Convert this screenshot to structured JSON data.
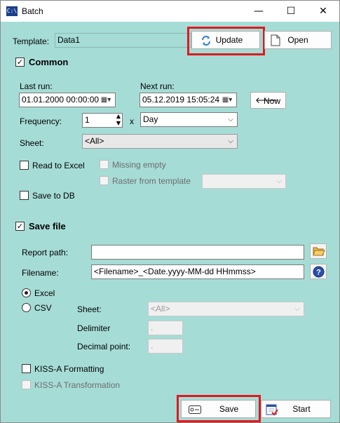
{
  "window": {
    "icon_text": "C:\\",
    "title": "Batch",
    "minimize": "—",
    "maximize": "☐",
    "close": "✕"
  },
  "template": {
    "label": "Template:",
    "value": "Data1",
    "update_label": "Update",
    "open_label": "Open"
  },
  "common": {
    "checked": true,
    "title": "Common",
    "last_run_label": "Last run:",
    "last_run_value": "01.01.2000 00:00:00",
    "next_run_label": "Next run:",
    "next_run_value": "05.12.2019 15:05:24",
    "now_label": "Now",
    "frequency_label": "Frequency:",
    "frequency_value": "1",
    "frequency_x": "x",
    "frequency_unit": "Day",
    "sheet_label": "Sheet:",
    "sheet_value": "<All>",
    "read_to_excel_label": "Read to Excel",
    "missing_empty_label": "Missing empty",
    "raster_label": "Raster from template",
    "save_to_db_label": "Save to DB"
  },
  "save_file": {
    "checked": true,
    "title": "Save file",
    "report_path_label": "Report path:",
    "report_path_value": "",
    "filename_label": "Filename:",
    "filename_value": "<Filename>_<Date.yyyy-MM-dd HHmmss>",
    "excel_label": "Excel",
    "csv_label": "CSV",
    "selected_format": "Excel",
    "sheet_label": "Sheet:",
    "sheet_value": "<All>",
    "delimiter_label": "Delimiter",
    "delimiter_value": ".",
    "decimal_label": "Decimal point:",
    "decimal_value": ".",
    "kiss_formatting_label": "KISS-A Formatting",
    "kiss_transformation_label": "KISS-A Transformation"
  },
  "footer": {
    "save_label": "Save",
    "start_label": "Start"
  },
  "colors": {
    "background": "#a6dcd6",
    "highlight": "#e0191f"
  }
}
